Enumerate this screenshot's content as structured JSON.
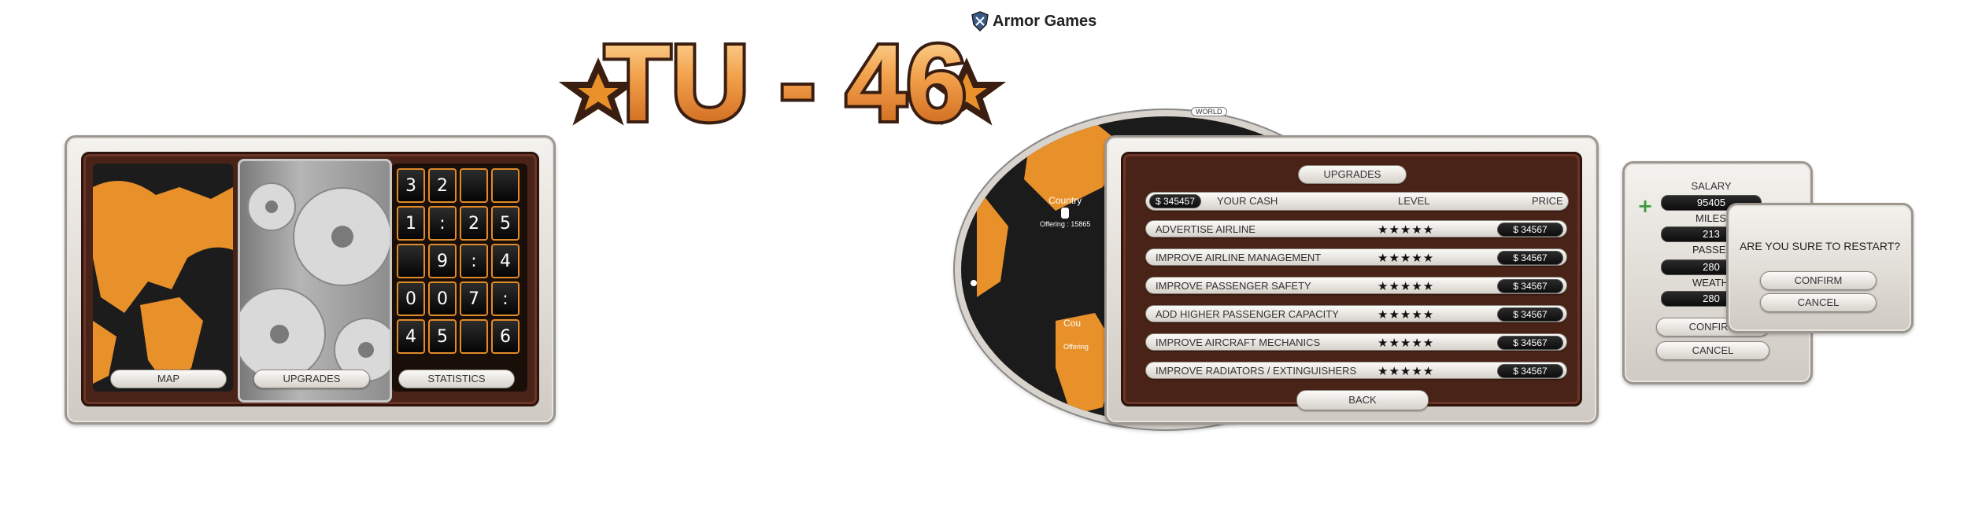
{
  "logo": {
    "title": "TU - 46",
    "brand": "Armor Games"
  },
  "menu": {
    "buttons": {
      "map": "MAP",
      "upgrades": "UPGRADES",
      "statistics": "STATISTICS"
    },
    "digits": [
      "3",
      "2",
      "",
      "",
      "1",
      ":",
      "2",
      "5",
      "",
      "9",
      ":",
      "4",
      "0",
      "0",
      "7",
      ":",
      "4",
      "5",
      "",
      "6"
    ]
  },
  "world": {
    "tag": "WORLD",
    "country1": "Country",
    "offering1": "Offering : 15865",
    "country2": "Cou",
    "offering2": "Offering"
  },
  "upgrades": {
    "title": "UPGRADES",
    "cash_value": "$ 345457",
    "cash_label": "YOUR CASH",
    "level_header": "LEVEL",
    "price_header": "PRICE",
    "items": [
      {
        "label": "ADVERTISE AIRLINE",
        "stars": "★★★★★",
        "price": "$ 34567"
      },
      {
        "label": "IMPROVE AIRLINE MANAGEMENT",
        "stars": "★★★★★",
        "price": "$ 34567"
      },
      {
        "label": "IMPROVE PASSENGER SAFETY",
        "stars": "★★★★★",
        "price": "$ 34567"
      },
      {
        "label": "ADD HIGHER PASSENGER CAPACITY",
        "stars": "★★★★★",
        "price": "$ 34567"
      },
      {
        "label": "IMPROVE AIRCRAFT MECHANICS",
        "stars": "★★★★★",
        "price": "$ 34567"
      },
      {
        "label": "IMPROVE RADIATORS / EXTINGUISHERS",
        "stars": "★★★★★",
        "price": "$ 34567"
      }
    ],
    "back": "BACK"
  },
  "salary": {
    "title": "SALARY",
    "salary_value": "95405",
    "miles_label": "MILES",
    "miles_value": "213",
    "passengers_label": "PASSENG",
    "passengers_value": "280",
    "weather_label": "WEATH",
    "weather_value": "280",
    "confirm": "CONFIRM",
    "cancel": "CANCEL",
    "plus_icon": "+"
  },
  "restart": {
    "question": "ARE YOU SURE TO RESTART?",
    "confirm": "CONFIRM",
    "cancel": "CANCEL"
  },
  "colors": {
    "accent": "#e8902a",
    "panel_brown": "#4a2318",
    "frame": "#d8d3cc"
  }
}
